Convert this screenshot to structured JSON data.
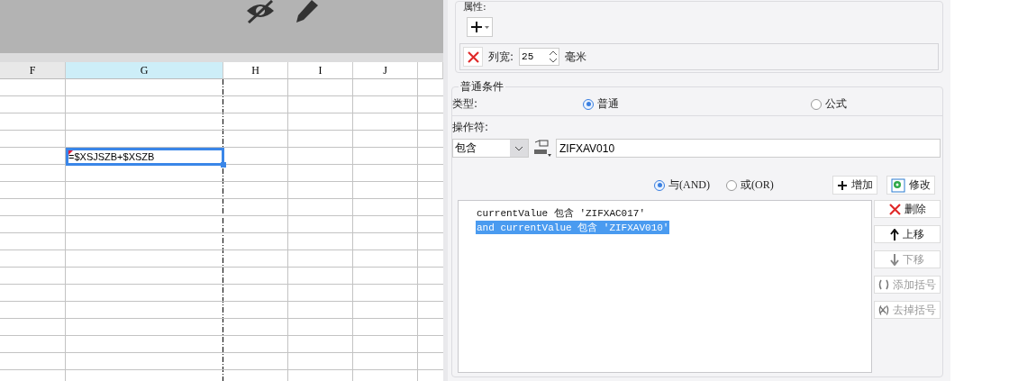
{
  "sheet": {
    "columns": [
      {
        "label": "F",
        "selected": false,
        "shaded": true
      },
      {
        "label": "G",
        "selected": true,
        "shaded": false
      },
      {
        "label": "H",
        "selected": false,
        "shaded": false
      },
      {
        "label": "I",
        "selected": false,
        "shaded": false
      },
      {
        "label": "J",
        "selected": false,
        "shaded": false
      }
    ],
    "active_cell": {
      "value": "=$XSJSZB+$XSZB"
    }
  },
  "properties": {
    "title": "属性:",
    "column_width": {
      "label": "列宽:",
      "value": "25",
      "unit": "毫米"
    }
  },
  "condition": {
    "title": "普通条件",
    "type_label": "类型:",
    "types": [
      {
        "label": "普通",
        "selected": true
      },
      {
        "label": "公式",
        "selected": false
      }
    ],
    "operator_label": "操作符:",
    "operator": "包含",
    "value": "ZIFXAV010",
    "joins": [
      {
        "label": "与(AND)",
        "selected": true
      },
      {
        "label": "或(OR)",
        "selected": false
      }
    ],
    "top_buttons": [
      {
        "kind": "add",
        "label": "增加"
      },
      {
        "kind": "edit",
        "label": "修改"
      }
    ],
    "items": [
      {
        "text": "currentValue 包含 'ZIFXAC017'",
        "selected": false
      },
      {
        "text": "and currentValue 包含 'ZIFXAV010'",
        "selected": true
      }
    ],
    "side_buttons": [
      {
        "kind": "delete",
        "label": "删除",
        "disabled": false
      },
      {
        "kind": "up",
        "label": "上移",
        "disabled": false
      },
      {
        "kind": "down",
        "label": "下移",
        "disabled": true
      },
      {
        "kind": "paren-add",
        "label": "添加括号",
        "disabled": true
      },
      {
        "kind": "paren-remove",
        "label": "去掉括号",
        "disabled": true
      }
    ]
  }
}
